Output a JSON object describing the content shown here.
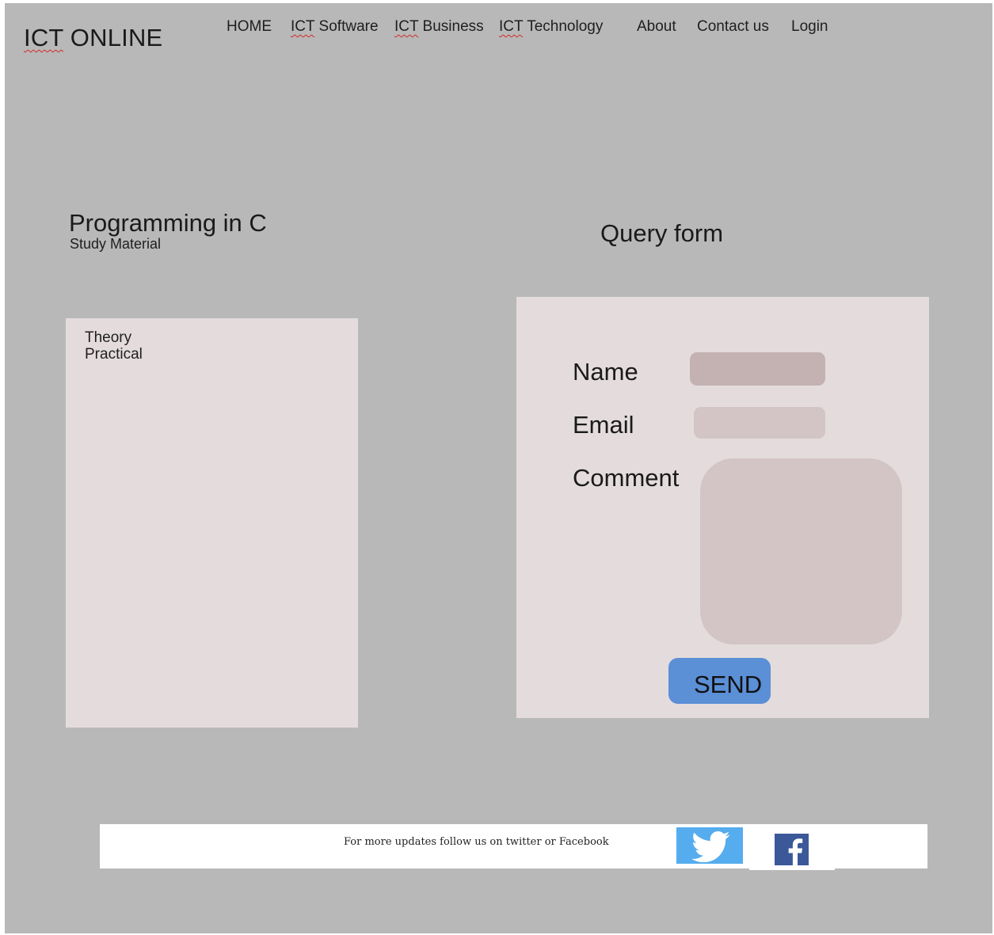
{
  "header": {
    "logo_prefix": "ICT",
    "logo_suffix": " ONLINE",
    "nav": {
      "home": "HOME",
      "software": {
        "prefix": "ICT",
        "suffix": " Software"
      },
      "business": {
        "prefix": "ICT",
        "suffix": " Business"
      },
      "technology": {
        "prefix": "ICT",
        "suffix": " Technology"
      },
      "about": "About",
      "contact": "Contact us",
      "login": "Login"
    }
  },
  "study": {
    "title": "Programming in C",
    "subtitle": "Study Material",
    "items": [
      "Theory",
      "Practical"
    ]
  },
  "query_form": {
    "title": "Query form",
    "name_label": "Name",
    "email_label": "Email",
    "comment_label": "Comment",
    "name_value": "",
    "email_value": "",
    "comment_value": "",
    "send_label": "SEND"
  },
  "footer": {
    "text": "For more updates follow us on twitter or Facebook",
    "twitter_icon": "twitter-bird-icon",
    "facebook_icon": "facebook-f-icon"
  },
  "colors": {
    "page_background": "#b8b8b8",
    "panel": "#e4dcdc",
    "name_input": "#c4b1b1",
    "input": "#d3c5c5",
    "send_button": "#5b8fd6",
    "twitter": "#55acee",
    "facebook": "#3b5998"
  }
}
